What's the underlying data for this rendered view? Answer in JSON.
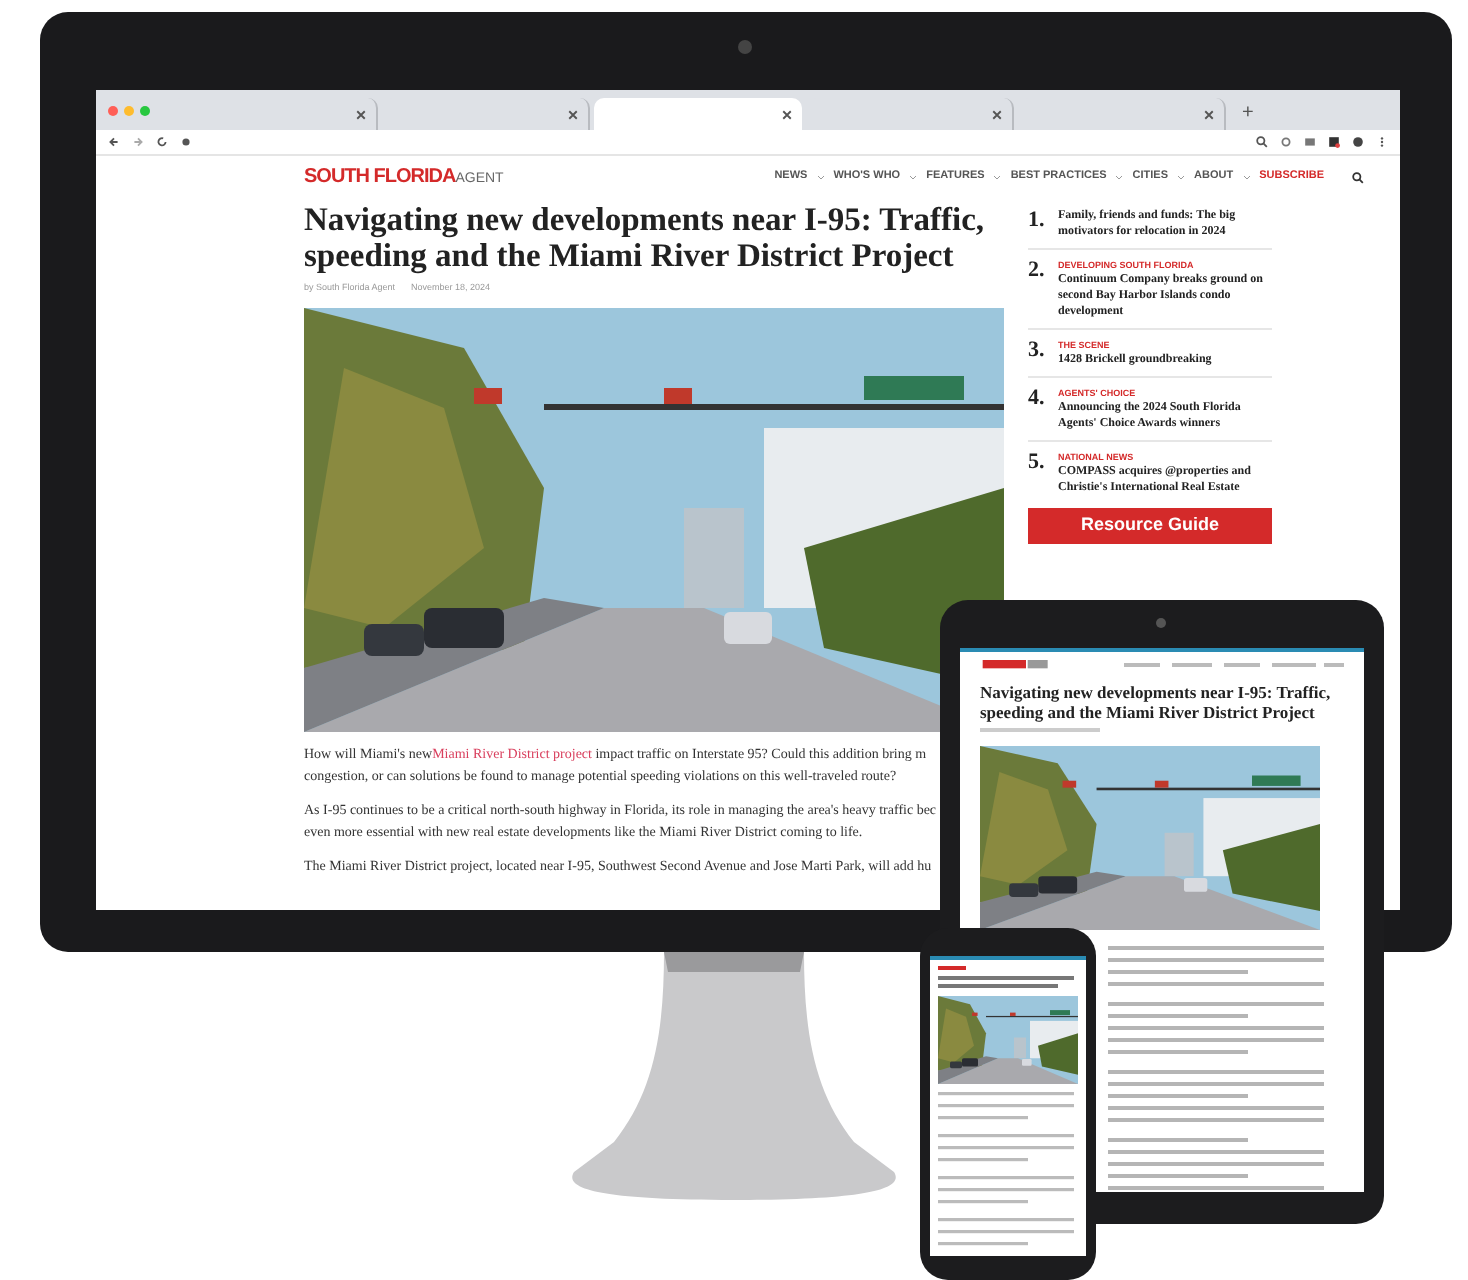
{
  "browser": {
    "tabs": [
      {
        "selected": false
      },
      {
        "selected": false
      },
      {
        "selected": true
      },
      {
        "selected": false
      },
      {
        "selected": false
      }
    ],
    "new_tab": "+"
  },
  "site": {
    "logo": {
      "main": "SOUTH FLORIDA",
      "accent": "AGENT"
    },
    "nav": [
      {
        "label": "NEWS",
        "kind": "menu"
      },
      {
        "label": "WHO'S WHO",
        "kind": "menu"
      },
      {
        "label": "FEATURES",
        "kind": "menu"
      },
      {
        "label": "BEST PRACTICES",
        "kind": "menu"
      },
      {
        "label": "CITIES",
        "kind": "menu"
      },
      {
        "label": "ABOUT",
        "kind": "menu"
      },
      {
        "label": "SUBSCRIBE",
        "kind": "cta"
      }
    ]
  },
  "article": {
    "title": "Navigating new developments near I-95: Traffic, speeding and the Miami River District Project",
    "byline": "by South Florida Agent",
    "date": "November 18, 2024",
    "paragraphs": [
      [
        {
          "before": "How will Miami's new ",
          "link": "Miami River District project",
          "after": " impact traffic on Interstate 95? Could this addition bring m"
        },
        {
          "before": "congestion, or can solutions be found to manage potential speeding violations on this well-traveled route?"
        }
      ],
      [
        {
          "before": "As I-95 continues to be a critical north-south highway in Florida, its role in managing the area's heavy traffic bec"
        },
        {
          "before": "even more essential with new real estate developments like the Miami River District coming to life."
        }
      ],
      [
        {
          "before": "The Miami River District project, located near I-95, Southwest Second Avenue and Jose Marti Park, will add hu"
        }
      ]
    ]
  },
  "sidebar": {
    "items": [
      {
        "number": "1.",
        "title": "Family, friends and funds: The big motivators for relocation in 2024"
      },
      {
        "number": "2.",
        "category": "DEVELOPING SOUTH FLORIDA",
        "title": "Continuum Company breaks ground on second Bay Harbor Islands condo development"
      },
      {
        "number": "3.",
        "category": "THE SCENE",
        "title": "1428 Brickell groundbreaking"
      },
      {
        "number": "4.",
        "category": "AGENTS' CHOICE",
        "title": "Announcing the 2024 South Florida Agents' Choice Awards winners"
      },
      {
        "number": "5.",
        "category": "NATIONAL NEWS",
        "title": "COMPASS acquires @properties and Christie's International Real Estate"
      }
    ],
    "banner": "Resource Guide"
  },
  "tablet": {
    "title": "Navigating new developments near I-95: Traffic, speeding and the Miami River District Project"
  }
}
